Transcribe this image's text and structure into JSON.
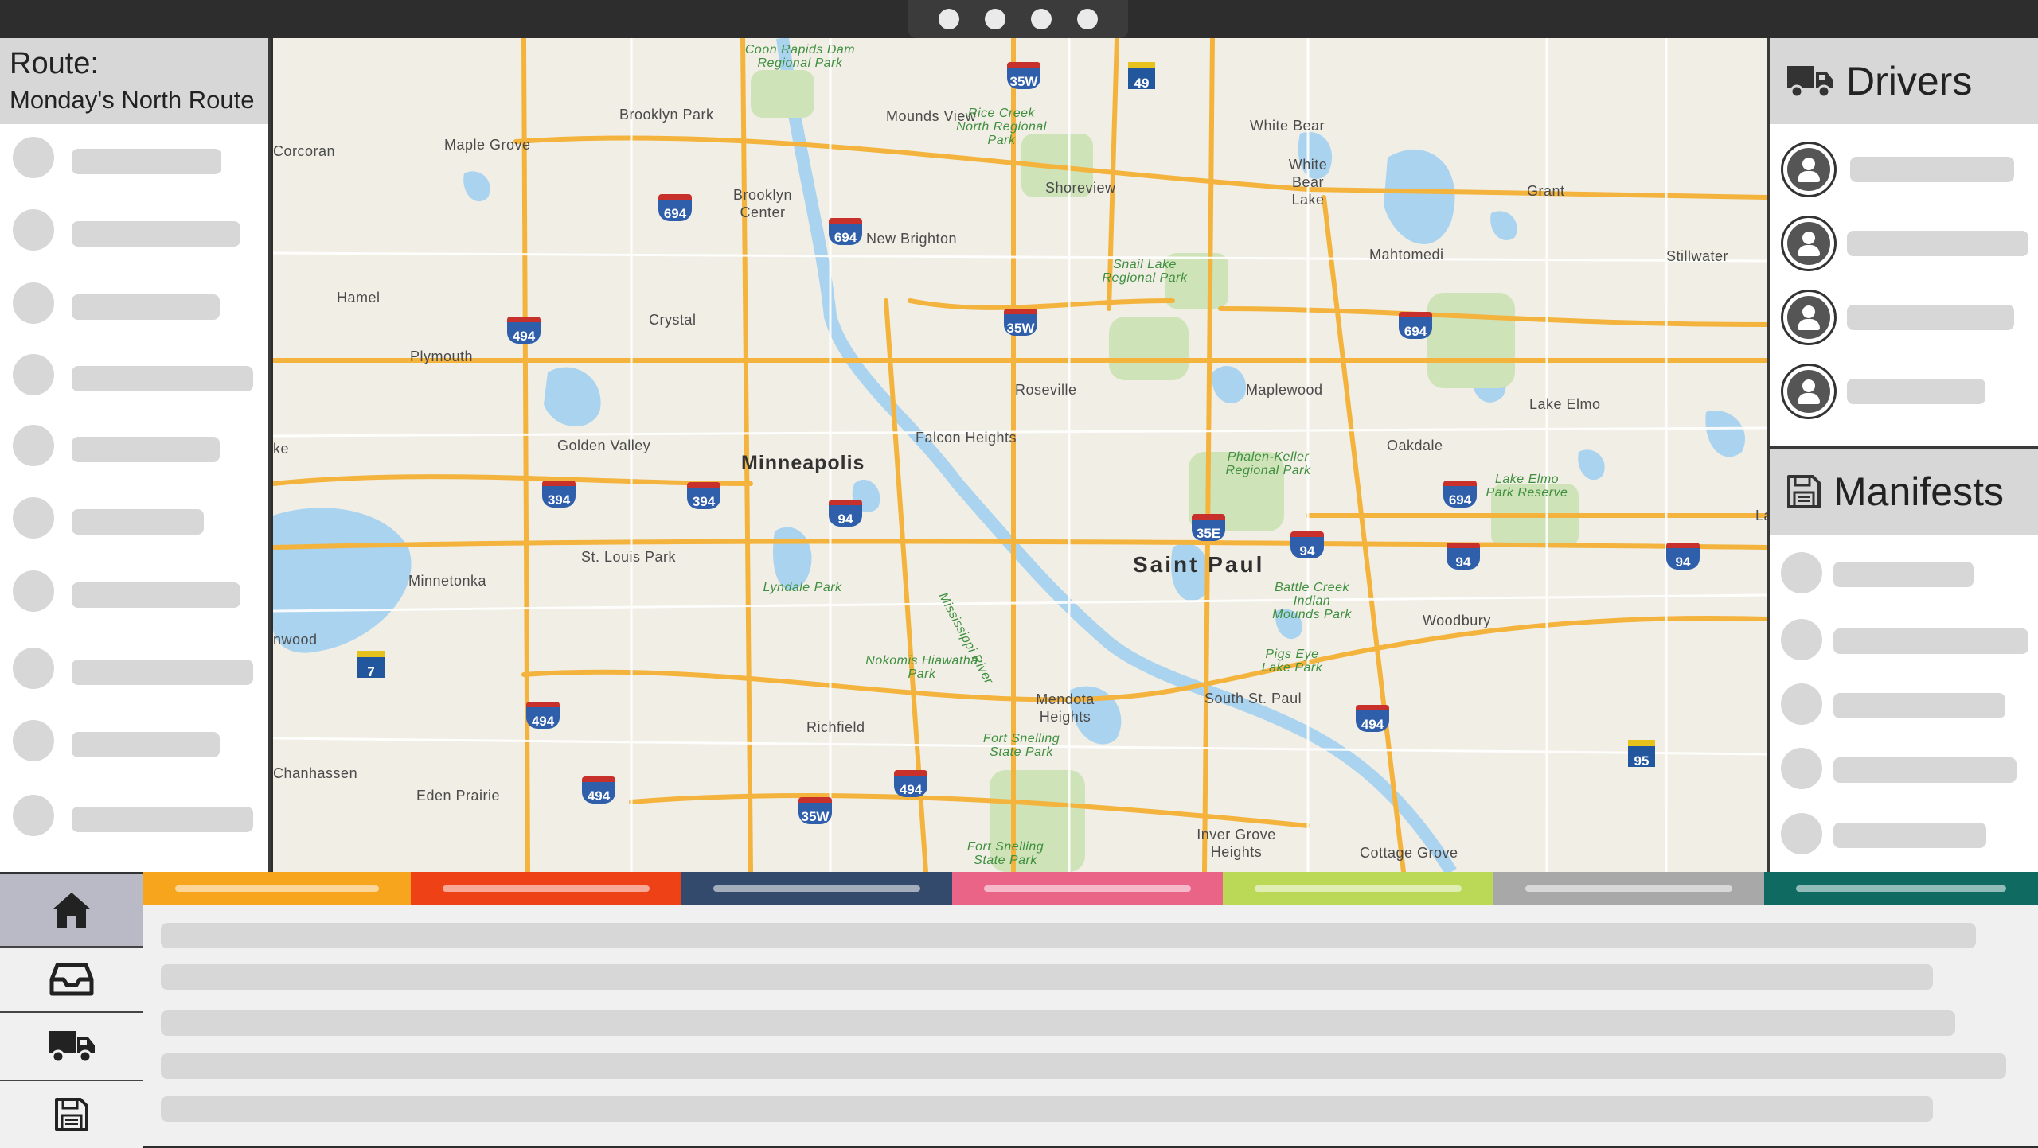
{
  "window": {
    "dots": [
      "dot-1",
      "dot-2",
      "dot-3",
      "dot-4"
    ]
  },
  "route": {
    "label": "Route:",
    "name": "Monday's North Route",
    "stops_placeholder_count": 10
  },
  "map": {
    "cities": [
      {
        "name": "Minneapolis"
      },
      {
        "name": "Saint Paul"
      }
    ],
    "places": [
      "Corcoran",
      "Maple Grove",
      "Brooklyn Park",
      "Mounds View",
      "White Bear",
      "White Bear Lake",
      "Grant",
      "Brooklyn Center",
      "Shoreview",
      "New Brighton",
      "Mahtomedi",
      "Stillwater",
      "Hamel",
      "Crystal",
      "Plymouth",
      "Roseville",
      "Maplewood",
      "Lake Elmo",
      "Golden Valley",
      "Falcon Heights",
      "Oakdale",
      "St. Louis Park",
      "Minnetonka",
      "Woodbury",
      "Mendota Heights",
      "South St. Paul",
      "Richfield",
      "Eden Prairie",
      "Chanhassen",
      "Inver Grove Heights",
      "Cottage Grove",
      "nwood",
      "ke",
      "La"
    ],
    "parks": [
      "Coon Rapids Dam Regional Park",
      "Rice Creek North Regional Park",
      "Snail Lake Regional Park",
      "Phalen-Keller Regional Park",
      "Lake Elmo Park Reserve",
      "Lyndale Park",
      "Battle Creek Indian Mounds Park",
      "Pigs Eye Lake Park",
      "Nokomis Hiawatha Park",
      "Fort Snelling State Park",
      "Fort Snelling State Park",
      "Mississippi River"
    ],
    "interstates": [
      "35W",
      "694",
      "694",
      "494",
      "35W",
      "694",
      "394",
      "394",
      "94",
      "35E",
      "94",
      "94",
      "94",
      "694",
      "494",
      "494",
      "494",
      "35W",
      "494"
    ],
    "state_routes": [
      "49",
      "7",
      "95"
    ]
  },
  "drivers": {
    "title": "Drivers",
    "icon": "truck-icon",
    "placeholder_count": 4
  },
  "manifests": {
    "title": "Manifests",
    "icon": "floppy-disk-icon",
    "placeholder_count": 5
  },
  "nav": {
    "items": [
      {
        "icon": "home-icon",
        "active": true
      },
      {
        "icon": "inbox-icon",
        "active": false
      },
      {
        "icon": "truck-icon",
        "active": false
      },
      {
        "icon": "floppy-disk-icon",
        "active": false
      }
    ]
  },
  "tabs": {
    "colors": [
      "#f7a51c",
      "#ee4115",
      "#344a6c",
      "#ea6488",
      "#bbd957",
      "#a8a8a8",
      "#0f6b62"
    ]
  },
  "content": {
    "line_count": 5
  }
}
